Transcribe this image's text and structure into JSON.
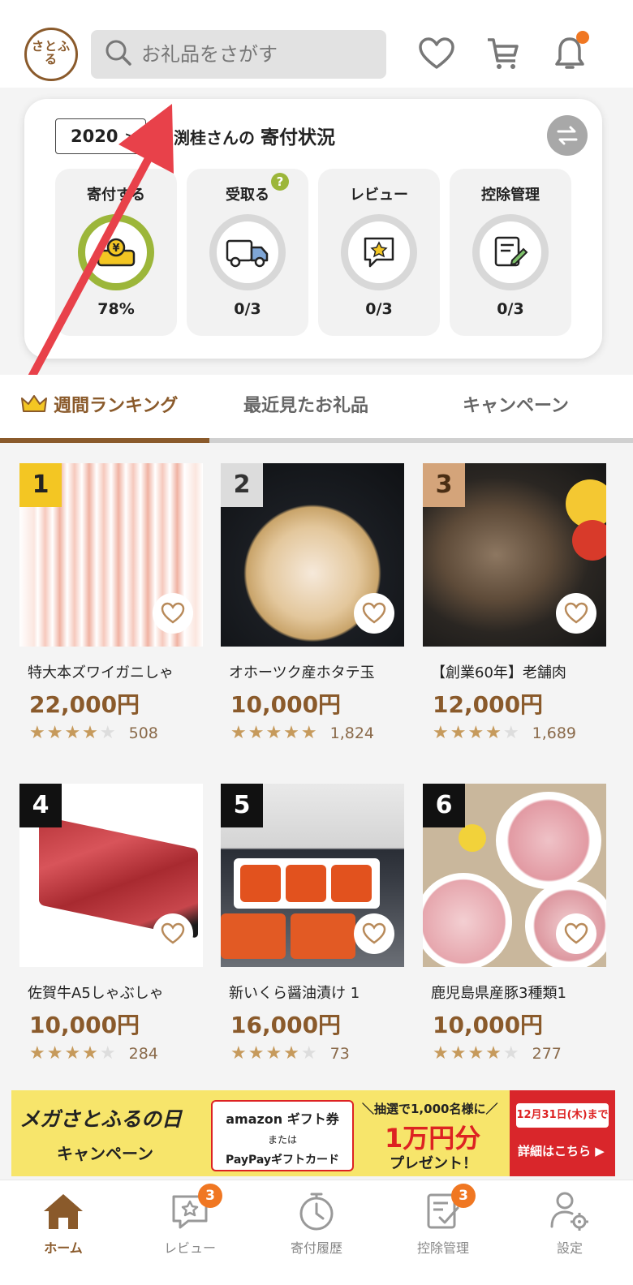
{
  "header": {
    "logo_text": "さとふる",
    "search_placeholder": "お礼品をさがす"
  },
  "status": {
    "year": "2020",
    "name_prefix": "渕桂さんの",
    "title": "寄付状況",
    "tiles": [
      {
        "label": "寄付する",
        "value": "78%",
        "progress": 0.78
      },
      {
        "label": "受取る",
        "value": "0/3",
        "help": "?"
      },
      {
        "label": "レビュー",
        "value": "0/3"
      },
      {
        "label": "控除管理",
        "value": "0/3"
      }
    ]
  },
  "tabs": [
    {
      "label": "週間ランキング",
      "active": true
    },
    {
      "label": "最近見たお礼品"
    },
    {
      "label": "キャンペーン"
    }
  ],
  "products": [
    {
      "rank": "1",
      "name": "特大本ズワイガニしゃ",
      "price": "22,000円",
      "rating": 4.5,
      "count": "508"
    },
    {
      "rank": "2",
      "name": "オホーツク産ホタテ玉",
      "price": "10,000円",
      "rating": 5,
      "count": "1,824"
    },
    {
      "rank": "3",
      "name": "【創業60年】老舗肉",
      "price": "12,000円",
      "rating": 4.5,
      "count": "1,689"
    },
    {
      "rank": "4",
      "name": "佐賀牛A5しゃぶしゃ",
      "price": "10,000円",
      "rating": 4.5,
      "count": "284"
    },
    {
      "rank": "5",
      "name": "新いくら醤油漬け 1",
      "price": "16,000円",
      "rating": 4.5,
      "count": "73"
    },
    {
      "rank": "6",
      "name": "鹿児島県産豚3種類1",
      "price": "10,000円",
      "rating": 4.5,
      "count": "277"
    }
  ],
  "banner": {
    "title": "メガさとふるの日",
    "subtitle": "キャンペーン",
    "amazon": "amazon ギフト券",
    "or": "または",
    "paypay": "PayPayギフトカード",
    "lottery": "＼抽選で1,000名様に／",
    "prize": "1万円分",
    "present": "プレゼント！",
    "deadline": "12月31日(木)まで",
    "detail": "詳細はこちら ▶"
  },
  "nav": [
    {
      "label": "ホーム",
      "icon": "home-icon",
      "active": true
    },
    {
      "label": "レビュー",
      "icon": "review-icon",
      "badge": "3"
    },
    {
      "label": "寄付履歴",
      "icon": "history-icon"
    },
    {
      "label": "控除管理",
      "icon": "deduction-icon",
      "badge": "3"
    },
    {
      "label": "設定",
      "icon": "settings-icon"
    }
  ],
  "colors": {
    "brand": "#8a5a2b",
    "accent": "#f07722",
    "progress": "#9cb63a",
    "star": "#c69a5c",
    "rank_gold": "#f3c623",
    "rank_silver": "#dcdcdc",
    "rank_bronze": "#d4a47a",
    "rank_other": "#111111"
  }
}
